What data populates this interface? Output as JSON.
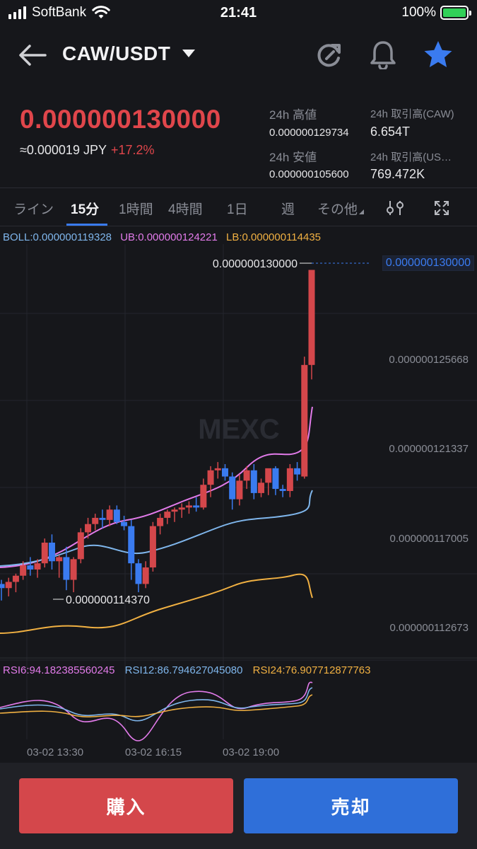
{
  "status": {
    "carrier": "SoftBank",
    "time": "21:41",
    "battery": "100%"
  },
  "header": {
    "pair": "CAW/USDT",
    "icons": [
      "back-arrow-icon",
      "caret-down-icon",
      "refresh-icon",
      "bell-icon",
      "star-icon"
    ]
  },
  "price": {
    "last": "0.000000130000",
    "jpy": "≈0.000019 JPY",
    "change": "+17.2%"
  },
  "stats": {
    "high_label": "24h 高値",
    "high_value": "0.000000129734",
    "low_label": "24h 安値",
    "low_value": "0.000000105600",
    "vol_caw_label": "24h 取引高(CAW)",
    "vol_caw_value": "6.654T",
    "vol_usdt_label": "24h 取引高(US…",
    "vol_usdt_value": "769.472K"
  },
  "tabs": [
    "ライン",
    "15分",
    "1時間",
    "4時間",
    "1日",
    "週",
    "その他"
  ],
  "active_tab": "15分",
  "indicators": {
    "boll": "BOLL:0.000000119328",
    "ub": "UB:0.000000124221",
    "lb": "LB:0.000000114435",
    "rsi6": "RSI6:94.182385560245",
    "rsi12": "RSI12:86.794627045080",
    "rsi24": "RSI24:76.907712877763"
  },
  "chart": {
    "current_price_tag": "0.000000130000",
    "high_marker": "0.000000130000",
    "low_marker": "0.000000114370",
    "axis_labels": [
      "0.000000125668",
      "0.000000121337",
      "0.000000117005",
      "0.000000112673"
    ],
    "time_labels": [
      "03-02 13:30",
      "03-02 16:15",
      "03-02 19:00"
    ],
    "watermark": "MEXC",
    "colors": {
      "up": "#d4474b",
      "down": "#3a7bf0",
      "ub": "#e27bea",
      "mid": "#7fb6ec",
      "lb": "#f0b042"
    }
  },
  "chart_data": {
    "type": "candlestick",
    "x_ticks": [
      "03-02 13:30",
      "03-02 16:15",
      "03-02 19:00"
    ],
    "y_ticks": [
      1.12673e-07,
      1.17005e-07,
      1.21337e-07,
      1.25668e-07
    ],
    "current_price": 1.3e-07,
    "visible_high": 1.3e-07,
    "visible_low": 1.1437e-07,
    "indicators": {
      "BOLL": 1.19328e-07,
      "UB": 1.24221e-07,
      "LB": 1.14435e-07,
      "RSI6": 94.182385560245,
      "RSI12": 86.79462704508,
      "RSI24": 76.907712877763
    },
    "candles": [
      {
        "o": 1.148e-07,
        "h": 1.15e-07,
        "l": 1.14e-07,
        "c": 1.146e-07
      },
      {
        "o": 1.146e-07,
        "h": 1.151e-07,
        "l": 1.142e-07,
        "c": 1.149e-07
      },
      {
        "o": 1.149e-07,
        "h": 1.153e-07,
        "l": 1.144e-07,
        "c": 1.152e-07
      },
      {
        "o": 1.152e-07,
        "h": 1.159e-07,
        "l": 1.15e-07,
        "c": 1.157e-07
      },
      {
        "o": 1.157e-07,
        "h": 1.161e-07,
        "l": 1.152e-07,
        "c": 1.155e-07
      },
      {
        "o": 1.155e-07,
        "h": 1.16e-07,
        "l": 1.151e-07,
        "c": 1.158e-07
      },
      {
        "o": 1.158e-07,
        "h": 1.17e-07,
        "l": 1.156e-07,
        "c": 1.168e-07
      },
      {
        "o": 1.168e-07,
        "h": 1.172e-07,
        "l": 1.155e-07,
        "c": 1.159e-07
      },
      {
        "o": 1.159e-07,
        "h": 1.162e-07,
        "l": 1.151e-07,
        "c": 1.161e-07
      },
      {
        "o": 1.161e-07,
        "h": 1.166e-07,
        "l": 1.145e-07,
        "c": 1.15e-07
      },
      {
        "o": 1.15e-07,
        "h": 1.161e-07,
        "l": 1.144e-07,
        "c": 1.16e-07
      },
      {
        "o": 1.16e-07,
        "h": 1.175e-07,
        "l": 1.158e-07,
        "c": 1.173e-07
      },
      {
        "o": 1.173e-07,
        "h": 1.18e-07,
        "l": 1.17e-07,
        "c": 1.177e-07
      },
      {
        "o": 1.177e-07,
        "h": 1.182e-07,
        "l": 1.174e-07,
        "c": 1.18e-07
      },
      {
        "o": 1.18e-07,
        "h": 1.184e-07,
        "l": 1.175e-07,
        "c": 1.179e-07
      },
      {
        "o": 1.179e-07,
        "h": 1.186e-07,
        "l": 1.176e-07,
        "c": 1.184e-07
      },
      {
        "o": 1.184e-07,
        "h": 1.186e-07,
        "l": 1.177e-07,
        "c": 1.178e-07
      },
      {
        "o": 1.178e-07,
        "h": 1.181e-07,
        "l": 1.174e-07,
        "c": 1.176e-07
      },
      {
        "o": 1.176e-07,
        "h": 1.179e-07,
        "l": 1.15e-07,
        "c": 1.158e-07
      },
      {
        "o": 1.158e-07,
        "h": 1.16e-07,
        "l": 1.144e-07,
        "c": 1.148e-07
      },
      {
        "o": 1.148e-07,
        "h": 1.159e-07,
        "l": 1.146e-07,
        "c": 1.156e-07
      },
      {
        "o": 1.156e-07,
        "h": 1.178e-07,
        "l": 1.154e-07,
        "c": 1.176e-07
      },
      {
        "o": 1.176e-07,
        "h": 1.182e-07,
        "l": 1.172e-07,
        "c": 1.18e-07
      },
      {
        "o": 1.18e-07,
        "h": 1.184e-07,
        "l": 1.177e-07,
        "c": 1.183e-07
      },
      {
        "o": 1.183e-07,
        "h": 1.185e-07,
        "l": 1.178e-07,
        "c": 1.184e-07
      },
      {
        "o": 1.184e-07,
        "h": 1.187e-07,
        "l": 1.18e-07,
        "c": 1.185e-07
      },
      {
        "o": 1.185e-07,
        "h": 1.188e-07,
        "l": 1.182e-07,
        "c": 1.186e-07
      },
      {
        "o": 1.186e-07,
        "h": 1.19e-07,
        "l": 1.183e-07,
        "c": 1.185e-07
      },
      {
        "o": 1.185e-07,
        "h": 1.199e-07,
        "l": 1.184e-07,
        "c": 1.196e-07
      },
      {
        "o": 1.196e-07,
        "h": 1.205e-07,
        "l": 1.19e-07,
        "c": 1.203e-07
      },
      {
        "o": 1.203e-07,
        "h": 1.207e-07,
        "l": 1.199e-07,
        "c": 1.204e-07
      },
      {
        "o": 1.204e-07,
        "h": 1.206e-07,
        "l": 1.198e-07,
        "c": 1.2e-07
      },
      {
        "o": 1.2e-07,
        "h": 1.202e-07,
        "l": 1.184e-07,
        "c": 1.189e-07
      },
      {
        "o": 1.189e-07,
        "h": 1.201e-07,
        "l": 1.186e-07,
        "c": 1.198e-07
      },
      {
        "o": 1.198e-07,
        "h": 1.205e-07,
        "l": 1.194e-07,
        "c": 1.203e-07
      },
      {
        "o": 1.203e-07,
        "h": 1.206e-07,
        "l": 1.189e-07,
        "c": 1.192e-07
      },
      {
        "o": 1.192e-07,
        "h": 1.199e-07,
        "l": 1.19e-07,
        "c": 1.197e-07
      },
      {
        "o": 1.197e-07,
        "h": 1.2e-07,
        "l": 1.191e-07,
        "c": 1.204e-07
      },
      {
        "o": 1.204e-07,
        "h": 1.205e-07,
        "l": 1.191e-07,
        "c": 1.194e-07
      },
      {
        "o": 1.194e-07,
        "h": 1.196e-07,
        "l": 1.19e-07,
        "c": 1.193e-07
      },
      {
        "o": 1.193e-07,
        "h": 1.206e-07,
        "l": 1.19e-07,
        "c": 1.204e-07
      },
      {
        "o": 1.204e-07,
        "h": 1.207e-07,
        "l": 1.198e-07,
        "c": 1.201e-07
      },
      {
        "o": 1.2e-07,
        "h": 1.258e-07,
        "l": 1.199e-07,
        "c": 1.254e-07
      },
      {
        "o": 1.254e-07,
        "h": 1.3e-07,
        "l": 1.247e-07,
        "c": 1.3e-07
      }
    ]
  },
  "buttons": {
    "buy": "購入",
    "sell": "売却"
  }
}
